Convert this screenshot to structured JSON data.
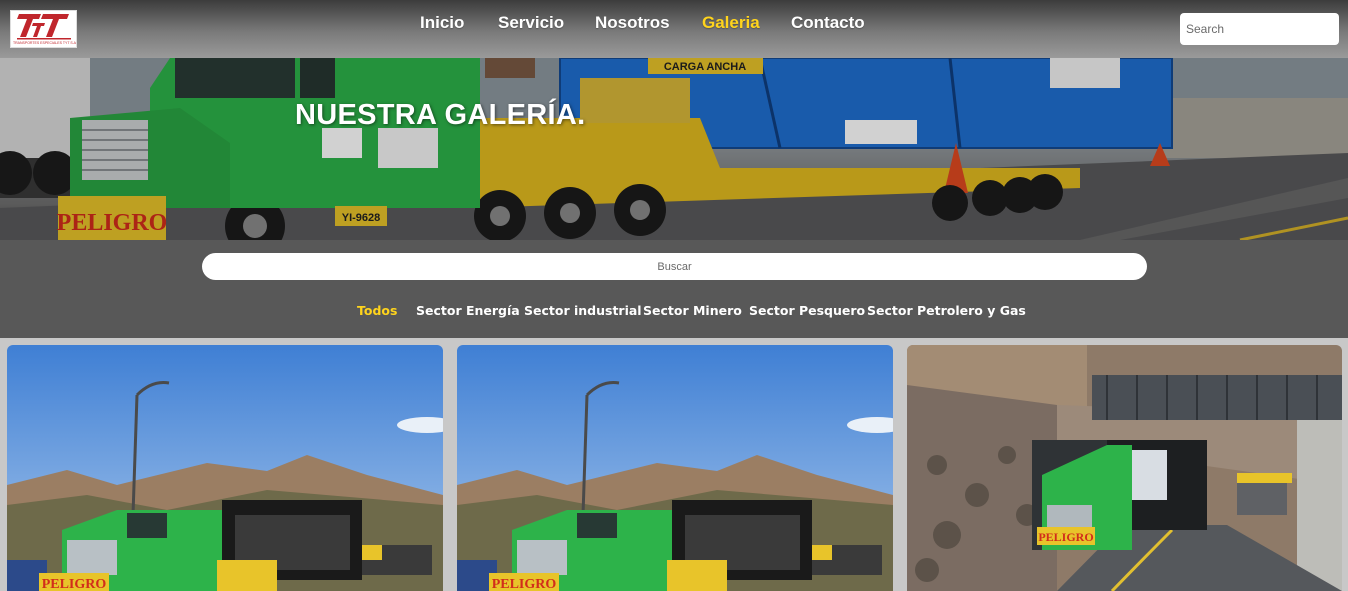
{
  "header": {
    "logo_text": "TRANSPORTES ESPECIALES TYT S.A.C.",
    "nav": [
      {
        "label": "Inicio",
        "active": false
      },
      {
        "label": "Servicio",
        "active": false
      },
      {
        "label": "Nosotros",
        "active": false
      },
      {
        "label": "Galeria",
        "active": true
      },
      {
        "label": "Contacto",
        "active": false
      }
    ],
    "search_placeholder": "Search"
  },
  "hero": {
    "title": "NUESTRA GALERÍA.",
    "truck_texts": {
      "warning": "PELIGRO",
      "plate": "YI-9628",
      "cargo_banner": "CARGA ANCHA"
    }
  },
  "gallery": {
    "search_placeholder": "Buscar",
    "filters": [
      {
        "label": "Todos",
        "active": true
      },
      {
        "label": "Sector Energía",
        "active": false
      },
      {
        "label": "Sector industrial",
        "active": false
      },
      {
        "label": "Sector Minero",
        "active": false
      },
      {
        "label": "Sector Pesquero",
        "active": false
      },
      {
        "label": "Sector Petrolero y Gas",
        "active": false
      }
    ],
    "cards": [
      {
        "alt": "Camión verde con carga en carretera",
        "sign": "PELIGRO"
      },
      {
        "alt": "Camión verde con carga en carretera",
        "sign": "PELIGRO"
      },
      {
        "alt": "Camión bajo puente en carretera de montaña",
        "sign": "PELIGRO"
      }
    ]
  },
  "colors": {
    "accent": "#ffd41c",
    "brand_red": "#c0262c",
    "truck_green": "#2db34a",
    "cargo_blue": "#1f6fd1"
  }
}
